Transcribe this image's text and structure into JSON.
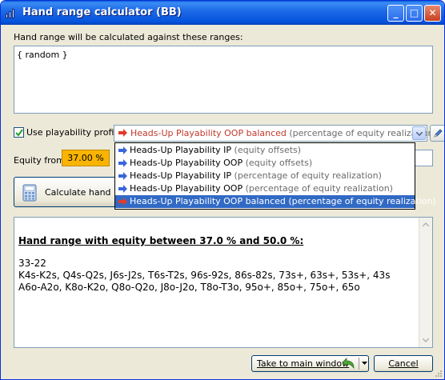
{
  "window": {
    "title": "Hand range calculator (BB)",
    "controls": {
      "minimize": "_",
      "maximize": "□",
      "close": "✕"
    }
  },
  "ranges": {
    "label": "Hand range will be calculated against these ranges:",
    "value": "{ random }"
  },
  "playability": {
    "checkbox_label": "Use playability profile:",
    "checked": true,
    "selected_name": "Heads-Up Playability OOP balanced",
    "selected_desc": "(percentage of equity realization)",
    "selected_arrow_color": "#e03c2a",
    "options": [
      {
        "name": "Heads-Up Playability IP",
        "desc": "(equity offsets)",
        "arrow_color": "#3a66d8",
        "selected": false
      },
      {
        "name": "Heads-Up Playability OOP",
        "desc": "(equity offsets)",
        "arrow_color": "#3a66d8",
        "selected": false
      },
      {
        "name": "Heads-Up Playability IP",
        "desc": "(percentage of equity realization)",
        "arrow_color": "#3a66d8",
        "selected": false
      },
      {
        "name": "Heads-Up Playability OOP",
        "desc": "(percentage of equity realization)",
        "arrow_color": "#3a66d8",
        "selected": false
      },
      {
        "name": "Heads-Up Playability OOP balanced",
        "desc": "(percentage of equity realization)",
        "arrow_color": "#e03c2a",
        "selected": true
      }
    ]
  },
  "equity": {
    "label": "Equity from",
    "from_value": "37.00 %",
    "accent_color": "#f8b400"
  },
  "calculate": {
    "label": "Calculate hand ran"
  },
  "result": {
    "heading": "Hand range with equity between 37.0 % and 50.0 %:",
    "lines": [
      "33-22",
      "K4s-K2s, Q4s-Q2s, J6s-J2s, T6s-T2s, 96s-92s, 86s-82s, 73s+, 63s+, 53s+, 43s",
      "A6o-A2o, K8o-K2o, Q8o-Q2o, J8o-J2o, T8o-T3o, 95o+, 85o+, 75o+, 65o"
    ]
  },
  "footer": {
    "take_label": "Take to main window",
    "cancel_label": "Cancel"
  }
}
